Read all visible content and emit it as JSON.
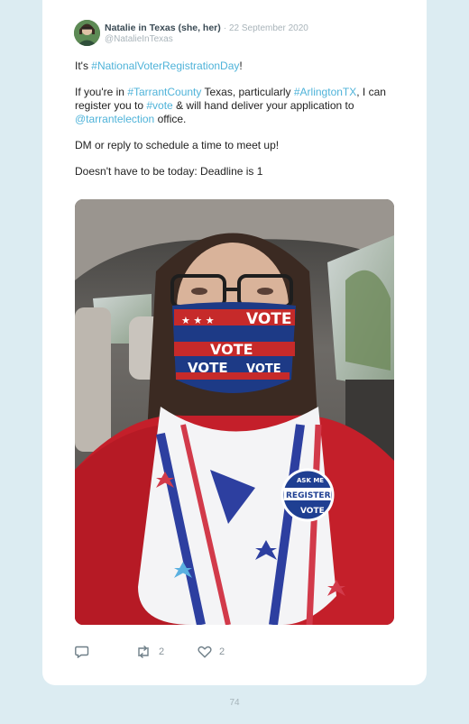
{
  "tweet": {
    "display_name": "Natalie in Texas (she, her)",
    "separator": "·",
    "date": "22 September 2020",
    "handle": "@NatalieInTexas",
    "line1_prefix": "It's ",
    "line1_tag": "#NationalVoterRegistrationDay",
    "line1_suffix": "!",
    "p2_a": "If you're in ",
    "p2_tag1": "#TarrantCounty",
    "p2_b": " Texas, particularly ",
    "p2_tag2": "#ArlingtonTX",
    "p2_c": ", I can register you to ",
    "p2_tag3": "#vote",
    "p2_d": " & will hand deliver your application to ",
    "p2_mention": "@tarrantelection",
    "p2_e": " office.",
    "p3": "DM or reply to schedule a time to meet up!",
    "p4": "Doesn't have to be today: Deadline is 1",
    "mask_text": "VOTE",
    "button_top": "ASK ME",
    "button_middle": "REGISTER",
    "button_bottom": "VOTE"
  },
  "actions": {
    "reply_icon": "reply-icon",
    "retweet_icon": "retweet-icon",
    "retweet_count": "2",
    "like_icon": "heart-icon",
    "like_count": "2"
  },
  "page": {
    "number": "74"
  },
  "colors": {
    "background": "#dcecf2",
    "hashtag": "#4fb3d9",
    "muted": "#a9b4ba"
  }
}
